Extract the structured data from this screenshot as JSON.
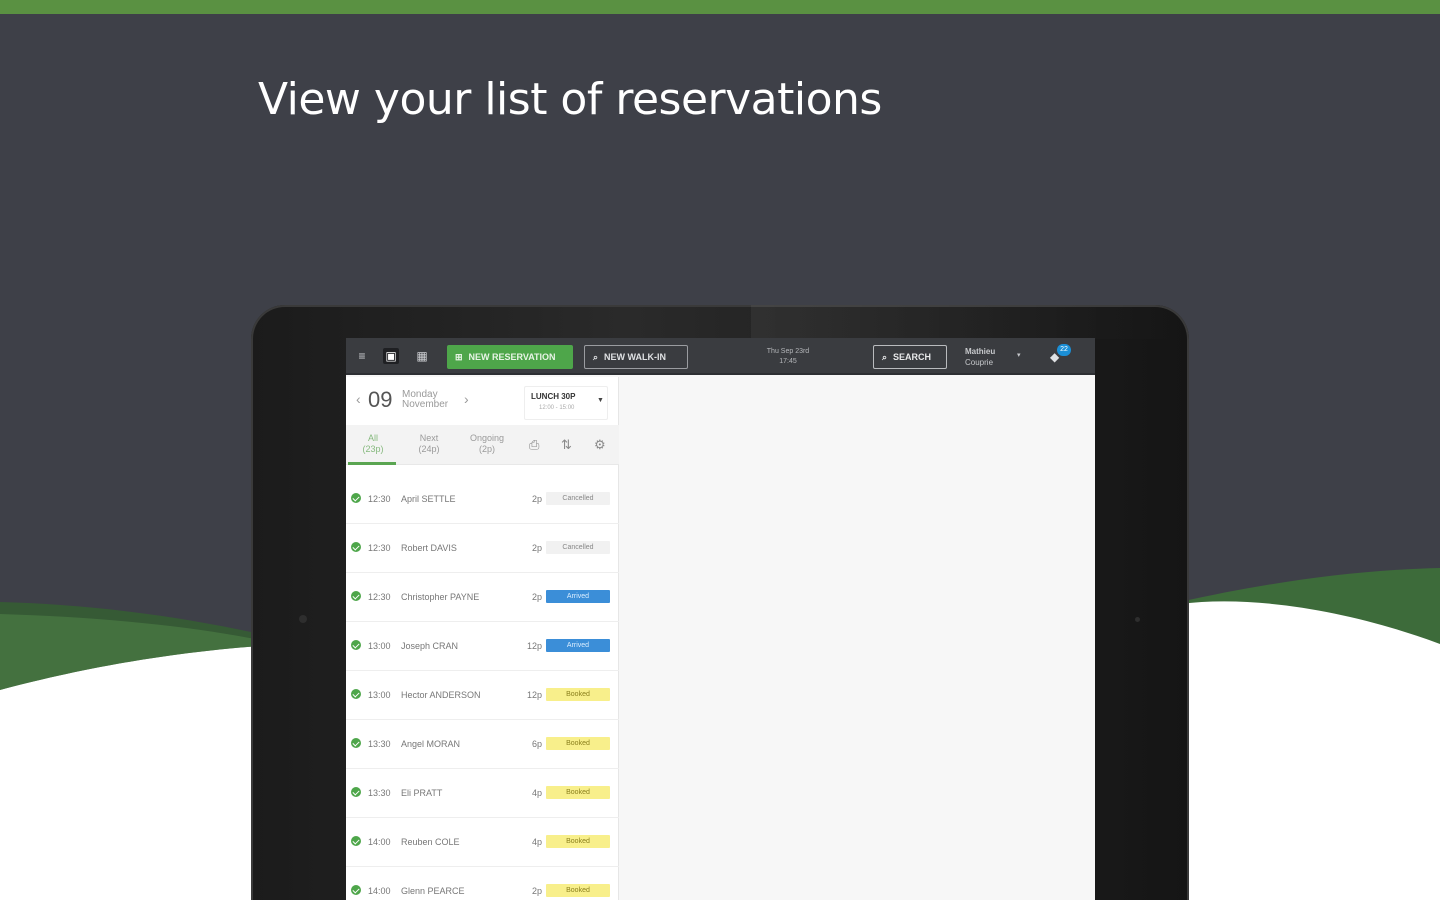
{
  "headline": "View your list of reservations",
  "colors": {
    "accent_green": "#5a9142",
    "dark_bg": "#3e4048",
    "badge_blue": "#1b8fd6"
  },
  "appbar": {
    "new_reservation": "NEW RESERVATION",
    "new_walkin": "NEW WALK-IN",
    "date_line1": "Thu Sep 23rd",
    "date_line2": "17:45",
    "search": "SEARCH",
    "user_first": "Mathieu",
    "user_last": "Couprie",
    "notifications": "22"
  },
  "date_nav": {
    "day": "09",
    "weekday": "Monday",
    "month": "November",
    "service_title": "LUNCH 30P",
    "service_sub": "12:00 - 15:00"
  },
  "filters": [
    {
      "label": "All",
      "count": "(23p)"
    },
    {
      "label": "Next",
      "count": "(24p)"
    },
    {
      "label": "Ongoing",
      "count": "(2p)"
    }
  ],
  "reservations": [
    {
      "time": "12:30",
      "name": "April SETTLE",
      "covers": "2p",
      "status": "Cancelled",
      "kind": "cancelled"
    },
    {
      "time": "12:30",
      "name": "Robert DAVIS",
      "covers": "2p",
      "status": "Cancelled",
      "kind": "cancelled"
    },
    {
      "time": "12:30",
      "name": "Christopher PAYNE",
      "covers": "2p",
      "status": "Arrived",
      "kind": "arrived"
    },
    {
      "time": "13:00",
      "name": "Joseph CRAN",
      "covers": "12p",
      "status": "Arrived",
      "kind": "arrived"
    },
    {
      "time": "13:00",
      "name": "Hector ANDERSON",
      "covers": "12p",
      "status": "Booked",
      "kind": "booked"
    },
    {
      "time": "13:30",
      "name": "Angel MORAN",
      "covers": "6p",
      "status": "Booked",
      "kind": "booked"
    },
    {
      "time": "13:30",
      "name": "Eli PRATT",
      "covers": "4p",
      "status": "Booked",
      "kind": "booked"
    },
    {
      "time": "14:00",
      "name": "Reuben COLE",
      "covers": "4p",
      "status": "Booked",
      "kind": "booked"
    },
    {
      "time": "14:00",
      "name": "Glenn PEARCE",
      "covers": "2p",
      "status": "Booked",
      "kind": "booked"
    }
  ]
}
